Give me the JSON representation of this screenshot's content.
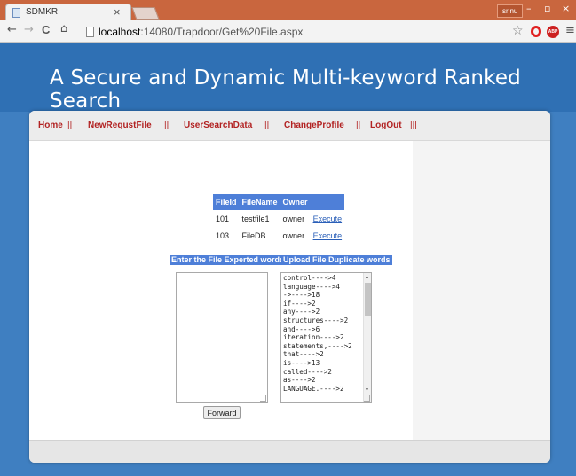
{
  "browser": {
    "tab_title": "SDMKR",
    "tab_close": "×",
    "user_label": "srinu",
    "win_minimize": "–",
    "win_restore": "▫",
    "win_close": "×",
    "nav_back": "←",
    "nav_forward": "→",
    "nav_reload": "C",
    "nav_home": "⌂",
    "url_host": "localhost",
    "url_path": ":14080/Trapdoor/Get%20File.aspx",
    "star": "☆",
    "abp_label": "ABP",
    "menu": "≡"
  },
  "site": {
    "title": "A Secure and Dynamic Multi-keyword Ranked Search"
  },
  "nav": {
    "items": [
      "Home",
      "NewRequstFile",
      "UserSearchData",
      "ChangeProfile",
      "LogOut"
    ],
    "separators": [
      "||",
      "||",
      "||",
      "||",
      "|||"
    ]
  },
  "files_table": {
    "headers": [
      "FileId",
      "FileName",
      "Owner",
      ""
    ],
    "rows": [
      {
        "id": "101",
        "name": "testfile1",
        "owner": "owner",
        "action": "Execute"
      },
      {
        "id": "103",
        "name": "FileDB",
        "owner": "owner",
        "action": "Execute"
      }
    ]
  },
  "labels": {
    "expected_words": "Enter the File Experted words",
    "duplicate_words": "Upload File Duplicate words"
  },
  "inputs": {
    "expected_words_value": "",
    "duplicate_words_value": "control---->4\nlanguage---->4\n->---->18\nif---->2\nany---->2\nstructures---->2\nand---->6\niteration---->2\nstatements,---->2\nthat---->2\nis---->13\ncalled---->2\nas---->2\nLANGUAGE.---->2"
  },
  "buttons": {
    "forward": "Forward"
  },
  "colors": {
    "banner": "#2f70b4",
    "page_bg": "#3f7fc1",
    "nav_link": "#b22222",
    "table_header": "#4e7fd8",
    "chrome_titlebar": "#c9663e"
  }
}
